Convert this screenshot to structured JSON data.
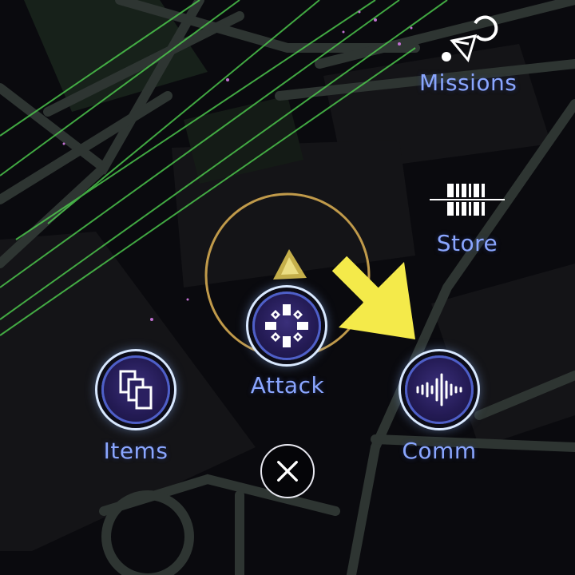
{
  "menu": {
    "missions_label": "Missions",
    "store_label": "Store",
    "attack_label": "Attack",
    "items_label": "Items",
    "comm_label": "Comm"
  },
  "colors": {
    "label": "#8aa6ff",
    "arrow": "#f4ea4a",
    "range_ring": "#c09a4a",
    "player_marker": "#e8d060",
    "orb_fill": "#2a2060",
    "orb_ring": "#d8e8ff",
    "map_lines": "#2f3a33",
    "link_lines": "#4fd04f"
  },
  "icons": {
    "missions": "compass-needle-icon",
    "store": "barcode-scale-icon",
    "attack": "crosshair-icon",
    "items": "stacked-cards-icon",
    "comm": "soundwave-icon",
    "close": "close-x-icon",
    "hint": "arrow-down-right-icon"
  }
}
